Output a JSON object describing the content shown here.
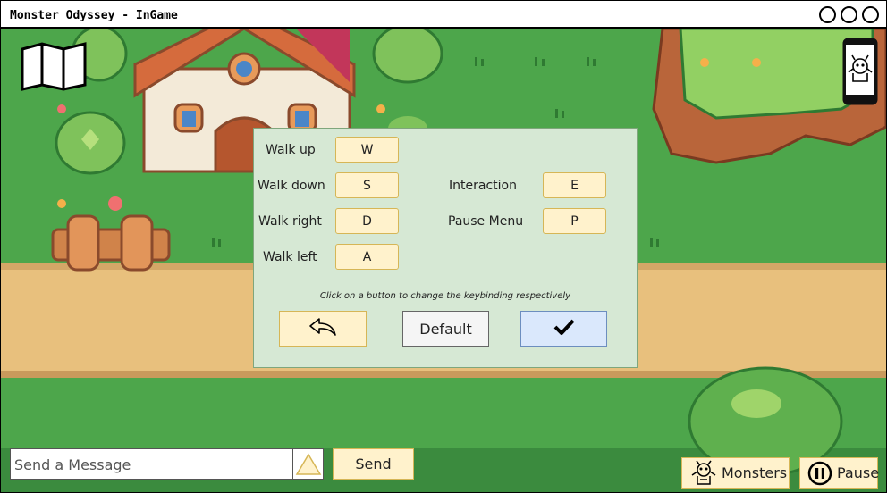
{
  "window": {
    "title": "Monster Odyssey - InGame"
  },
  "colors": {
    "grass": "#4da64b",
    "path": "#e8c07d",
    "dialog": "#d6e8d4",
    "key_button": "#fff2cc",
    "confirm_button": "#dae8fc"
  },
  "keybindings": {
    "walk_up": {
      "label": "Walk up",
      "key": "W"
    },
    "walk_down": {
      "label": "Walk down",
      "key": "S"
    },
    "walk_right": {
      "label": "Walk right",
      "key": "D"
    },
    "walk_left": {
      "label": "Walk left",
      "key": "A"
    },
    "interaction": {
      "label": "Interaction",
      "key": "E"
    },
    "pause_menu": {
      "label": "Pause Menu",
      "key": "P"
    },
    "hint": "Click on a button to change the keybinding respectively",
    "default_label": "Default",
    "back_icon": "back-arrow-icon",
    "confirm_icon": "checkmark-icon"
  },
  "hud": {
    "map_icon": "map-icon",
    "phone_icon": "phone-icon"
  },
  "chat": {
    "placeholder": "Send a Message",
    "send_label": "Send",
    "arrow_icon": "triangle-up-icon"
  },
  "buttons": {
    "monsters_label": "Monsters",
    "pause_label": "Pause",
    "monster_icon": "monster-icon",
    "pause_icon": "pause-icon"
  }
}
